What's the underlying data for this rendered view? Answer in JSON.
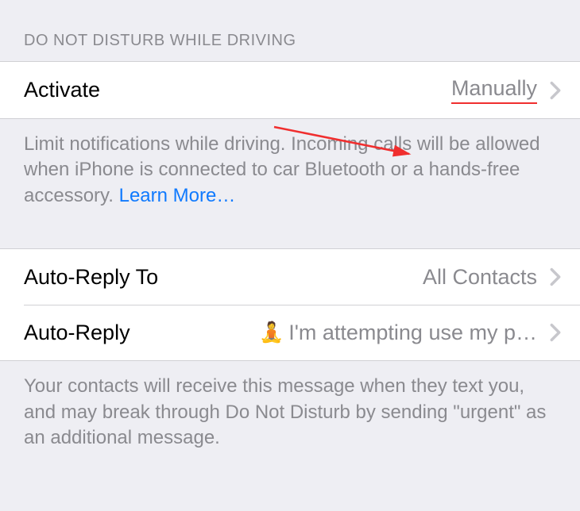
{
  "section1": {
    "header": "DO NOT DISTURB WHILE DRIVING",
    "activate": {
      "label": "Activate",
      "value": "Manually"
    },
    "footer": "Limit notifications while driving. Incoming calls will be allowed when iPhone is connected to car Bluetooth or a hands-free accessory. ",
    "footer_link": "Learn More…"
  },
  "section2": {
    "auto_reply_to": {
      "label": "Auto-Reply To",
      "value": "All Contacts"
    },
    "auto_reply": {
      "label": "Auto-Reply",
      "emoji": "🧘",
      "value": "I'm attempting use my p…"
    },
    "footer": "Your contacts will receive this message when they text you, and may break through Do Not Disturb by sending \"urgent\" as an additional message."
  },
  "annotation": {
    "arrow_color": "#f02e2e"
  }
}
